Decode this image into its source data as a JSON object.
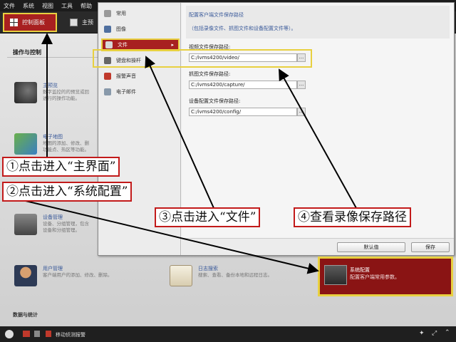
{
  "menubar": {
    "items": [
      "文件",
      "系统",
      "视图",
      "工具",
      "帮助"
    ]
  },
  "tabs": {
    "active": "控制面板",
    "second": "主预"
  },
  "panel": {
    "section_title": "操作与控制",
    "bottom_section": "数据与统计",
    "modules": {
      "preview": {
        "title": "主预览",
        "desc1": "数字监控的的预览或回",
        "desc2": "进行的操作功能。"
      },
      "emap": {
        "title": "电子地图",
        "desc1": "地图的添加、修改、删",
        "desc2": "功能点、热区等功能。"
      },
      "device": {
        "title": "设备管理",
        "desc1": "设备、分组管理，包含",
        "desc2": "设备和分组管理。"
      },
      "user": {
        "title": "用户管理",
        "desc1": "客户端用户的添加、修改、删除。"
      },
      "log": {
        "title": "日志搜索",
        "desc1": "搜索、查看、备份本地和远程日志。"
      }
    }
  },
  "dialog": {
    "sidebar": [
      {
        "label": "常用",
        "icon": "settings-icon"
      },
      {
        "label": "图像",
        "icon": "image-icon"
      },
      {
        "label": "文件",
        "icon": "file-icon",
        "arrow": "▸"
      },
      {
        "label": "键盘和操杆",
        "icon": "keyboard-icon"
      },
      {
        "label": "报警声音",
        "icon": "alarm-sound-icon"
      },
      {
        "label": "电子邮件",
        "icon": "email-icon"
      }
    ],
    "info_title": "配置客户端文件保存路径",
    "info_desc": "（包括录像文件、抓图文件和设备配置文件等）。",
    "fields": [
      {
        "label": "视频文件保存路径:",
        "value": "C:/ivms4200/video/",
        "button": "..."
      },
      {
        "label": "抓图文件保存路径:",
        "value": "C:/ivms4200/capture/",
        "button": "..."
      },
      {
        "label": "设备配置文件保存路径:",
        "value": "C:/ivms4200/config/",
        "button": "..."
      }
    ],
    "default_button": "默认值",
    "save_button": "保存"
  },
  "sys_config": {
    "title": "系统配置",
    "desc": "配置客户端常用参数。"
  },
  "statusbar": {
    "text": "移动侦测报警"
  },
  "callouts": {
    "step1": "①点击进入“主界面”",
    "step2": "②点击进入“系统配置”",
    "step3": "③点击进入“文件”",
    "step4": "④查看录像保存路径"
  },
  "colors": {
    "accent_red": "#a82020",
    "highlight_yellow": "#e8d040",
    "callout_border": "#c21a1a"
  }
}
